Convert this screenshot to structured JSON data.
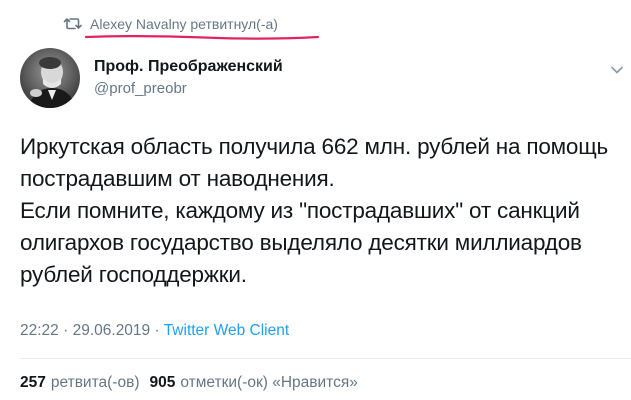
{
  "retweet": {
    "text": "Alexey Navalny ретвитнул(-а)"
  },
  "author": {
    "display_name": "Проф. Преображенский",
    "handle": "@prof_preobr"
  },
  "tweet": {
    "line1": "Иркутская область получила 662 млн. рублей на помощь\nпострадавшим от наводнения.",
    "line2": "Если помните, каждому из \"пострадавших\" от санкций\nолигархов государство выделяло десятки миллиардов\nрублей господдержки."
  },
  "meta": {
    "time": "22:22",
    "separator": "·",
    "date": "29.06.2019",
    "client": "Twitter Web Client"
  },
  "stats": {
    "retweets_count": "257",
    "retweets_label": "ретвита(-ов)",
    "likes_count": "905",
    "likes_label": "отметки(-ок) «Нравится»"
  },
  "colors": {
    "secondary_text": "#657786",
    "link": "#1da1f2",
    "highlight_underline": "#e0245e"
  },
  "icons": {
    "retweet": "retweet-icon",
    "menu": "chevron-down-icon",
    "avatar": "avatar-photo"
  }
}
